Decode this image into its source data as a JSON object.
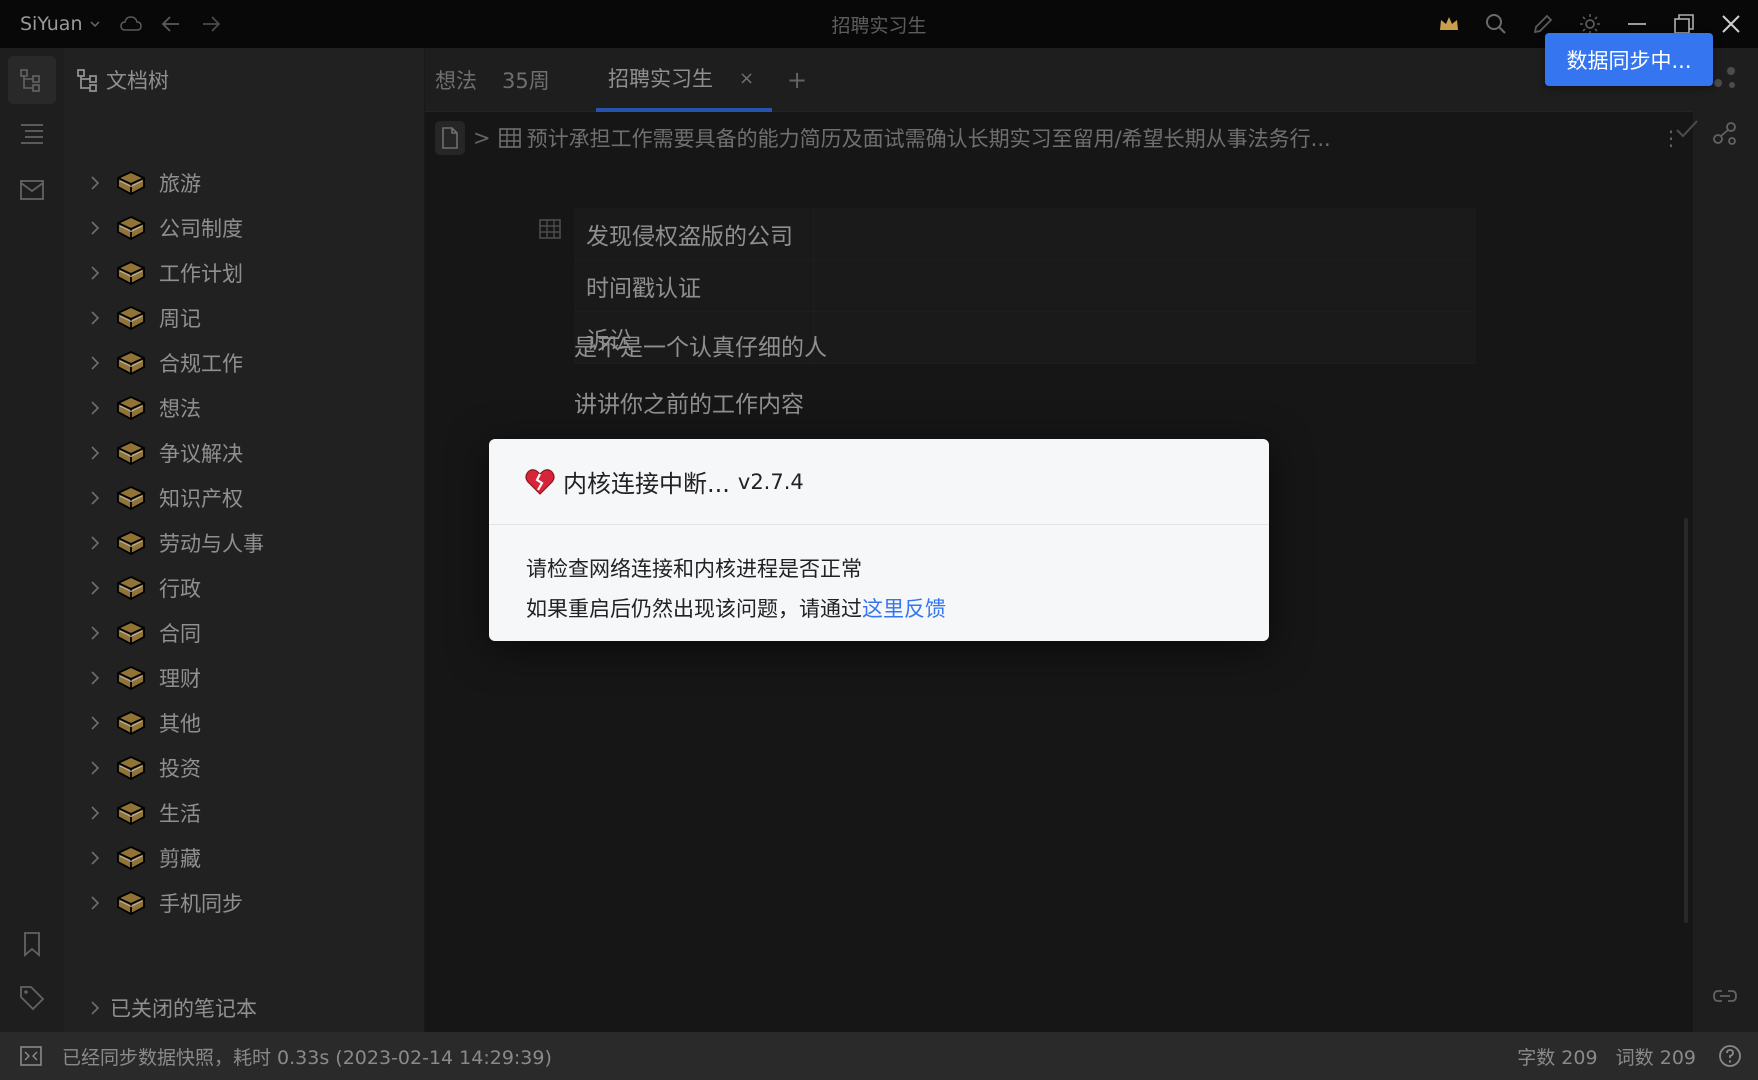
{
  "app": {
    "brand": "SiYuan",
    "window_title": "招聘实习生"
  },
  "titlebar": {
    "icons": [
      "cloud-icon",
      "back-icon",
      "forward-icon",
      "crown-icon",
      "search-icon",
      "edit-icon",
      "theme-icon",
      "minimize-icon",
      "restore-icon",
      "close-icon"
    ]
  },
  "filetree": {
    "title": "文档树",
    "notebooks": [
      "旅游",
      "公司制度",
      "工作计划",
      "周记",
      "合规工作",
      "想法",
      "争议解决",
      "知识产权",
      "劳动与人事",
      "行政",
      "合同",
      "理财",
      "其他",
      "投资",
      "生活",
      "剪藏",
      "手机同步"
    ],
    "closed_label": "已关闭的笔记本"
  },
  "tabs": [
    {
      "label": "想法"
    },
    {
      "label": "35周"
    },
    {
      "label": "招聘实习生",
      "active": true
    }
  ],
  "tab_close": "×",
  "tab_add": "+",
  "breadcrumb": {
    "separator": ">",
    "text": "预计承担工作需要具备的能力简历及面试需确认长期实习至留用/希望长期从事法务行...",
    "more": "⋮"
  },
  "content": {
    "table_rows": [
      "发现侵权盗版的公司",
      "时间戳认证",
      "诉讼"
    ],
    "paragraphs": [
      "是不是一个认真仔细的人",
      "讲讲你之前的工作内容"
    ]
  },
  "dialog": {
    "title": "内核连接中断...",
    "version": "v2.7.4",
    "line1": "请检查网络连接和内核进程是否正常",
    "line2": "如果重启后仍然出现该问题，请通过",
    "link": "这里反馈"
  },
  "sync_toast": "数据同步中...",
  "statusbar": {
    "message": "已经同步数据快照，耗时 0.33s (2023-02-14 14:29:39)",
    "char_label": "字数",
    "char_count": "209",
    "word_label": "词数",
    "word_count": "209"
  },
  "colors": {
    "accent": "#3575f0",
    "link": "#3575f0",
    "book_gold": "#c8a04a"
  }
}
